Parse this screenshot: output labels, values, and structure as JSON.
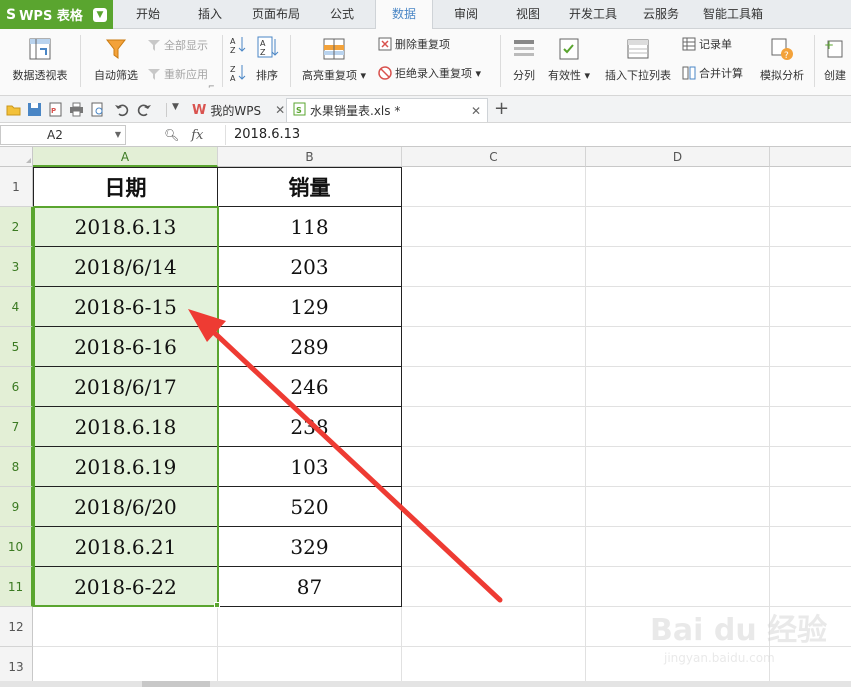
{
  "app": {
    "logo": "WPS 表格"
  },
  "menu": {
    "tabs": [
      "开始",
      "插入",
      "页面布局",
      "公式",
      "数据",
      "审阅",
      "视图",
      "开发工具",
      "云服务",
      "智能工具箱"
    ],
    "active": "数据"
  },
  "ribbon": {
    "pivot": "数据透视表",
    "autofilter": "自动筛选",
    "show_all": "全部显示",
    "reapply": "重新应用",
    "sort": "排序",
    "highlight_dup": "高亮重复项",
    "remove_dup": "删除重复项",
    "reject_dup": "拒绝录入重复项",
    "split": "分列",
    "validity": "有效性",
    "dropdown": "插入下拉列表",
    "record": "记录单",
    "merge_calc": "合并计算",
    "simulate": "模拟分析",
    "create": "创建"
  },
  "doctabs": {
    "my_wps": "我的WPS",
    "file": "水果销量表.xls *"
  },
  "formula_bar": {
    "cell_ref": "A2",
    "fx": "fx",
    "value": "2018.6.13"
  },
  "sheet": {
    "columns": [
      "A",
      "B",
      "C",
      "D"
    ],
    "rows": [
      "1",
      "2",
      "3",
      "4",
      "5",
      "6",
      "7",
      "8",
      "9",
      "10",
      "11",
      "12",
      "13"
    ],
    "header": {
      "date": "日期",
      "sales": "销量"
    },
    "data": [
      {
        "date": "2018.6.13",
        "sales": "118"
      },
      {
        "date": "2018/6/14",
        "sales": "203"
      },
      {
        "date": "2018-6-15",
        "sales": "129"
      },
      {
        "date": "2018-6-16",
        "sales": "289"
      },
      {
        "date": "2018/6/17",
        "sales": "246"
      },
      {
        "date": "2018.6.18",
        "sales": "238"
      },
      {
        "date": "2018.6.19",
        "sales": "103"
      },
      {
        "date": "2018/6/20",
        "sales": "520"
      },
      {
        "date": "2018.6.21",
        "sales": "329"
      },
      {
        "date": "2018-6-22",
        "sales": "87"
      }
    ]
  },
  "colors": {
    "accent": "#5aa52f",
    "selection": "#e3f2db",
    "arrow": "#ee3b33",
    "active_tab_text": "#4a86c5"
  },
  "watermark": {
    "brand": "Bai du 经验",
    "url": "jingyan.baidu.com"
  }
}
